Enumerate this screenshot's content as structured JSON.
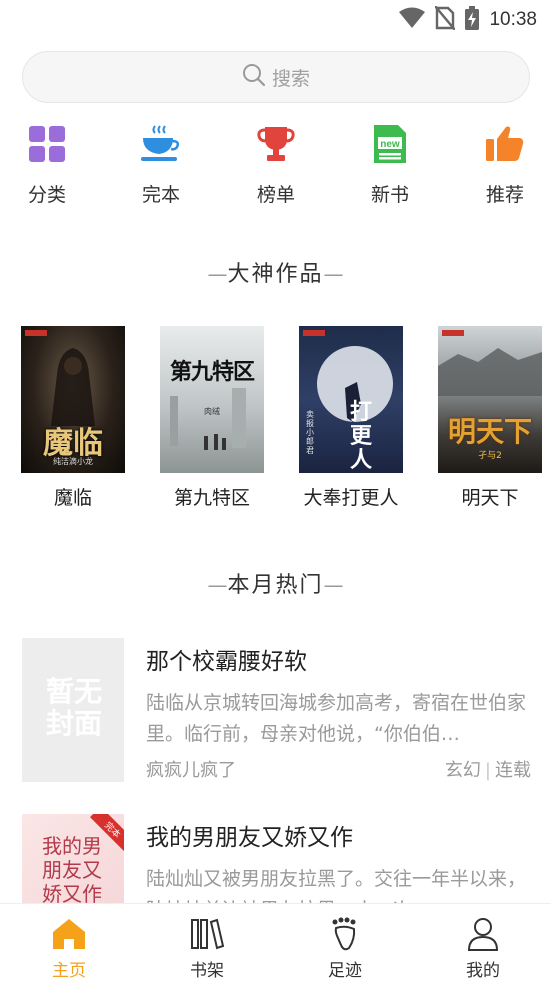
{
  "status_bar": {
    "time": "10:38"
  },
  "search": {
    "placeholder": "搜索"
  },
  "categories": [
    {
      "label": "分类",
      "icon": "grid-icon",
      "color": "#9a6ddb"
    },
    {
      "label": "完本",
      "icon": "coffee-cup-icon",
      "color": "#2e8fe0"
    },
    {
      "label": "榜单",
      "icon": "trophy-icon",
      "color": "#e0443c"
    },
    {
      "label": "新书",
      "icon": "new-badge-icon",
      "color": "#3dbb4f"
    },
    {
      "label": "推荐",
      "icon": "thumbs-up-icon",
      "color": "#f5832a"
    }
  ],
  "sections": {
    "featured_title": "大神作品",
    "hot_title": "本月热门"
  },
  "featured_books": [
    {
      "title": "魔临",
      "cover_text": "魔临",
      "cover_author": "纯洁滴小龙"
    },
    {
      "title": "第九特区",
      "cover_text": "第九特区",
      "cover_author": "肉绒"
    },
    {
      "title": "大奉打更人",
      "cover_text": "打更人",
      "cover_author": "卖报小郎君"
    },
    {
      "title": "明天下",
      "cover_text": "明天下",
      "cover_author": "孑与2"
    }
  ],
  "hot_books": [
    {
      "title": "那个校霸腰好软",
      "desc": "陆临从京城转回海城参加高考，寄宿在世伯家里。临行前，母亲对他说，“你伯伯…",
      "author": "疯疯儿疯了",
      "tag1": "玄幻",
      "tag2": "连载",
      "cover_placeholder": "暂无封面"
    },
    {
      "title": "我的男朋友又娇又作",
      "desc": "陆灿灿又被男朋友拉黑了。交往一年半以来，陆灿灿单边被男友拉黑二十一次",
      "cover_text": "我的男朋友又娇又作",
      "cover_badge": "完本"
    }
  ],
  "bottom_nav": [
    {
      "label": "主页",
      "icon": "home-icon",
      "active": true
    },
    {
      "label": "书架",
      "icon": "bookshelf-icon",
      "active": false
    },
    {
      "label": "足迹",
      "icon": "footprint-icon",
      "active": false
    },
    {
      "label": "我的",
      "icon": "person-icon",
      "active": false
    }
  ],
  "colors": {
    "accent": "#f5a21a",
    "muted_text": "#9a9a9a"
  }
}
